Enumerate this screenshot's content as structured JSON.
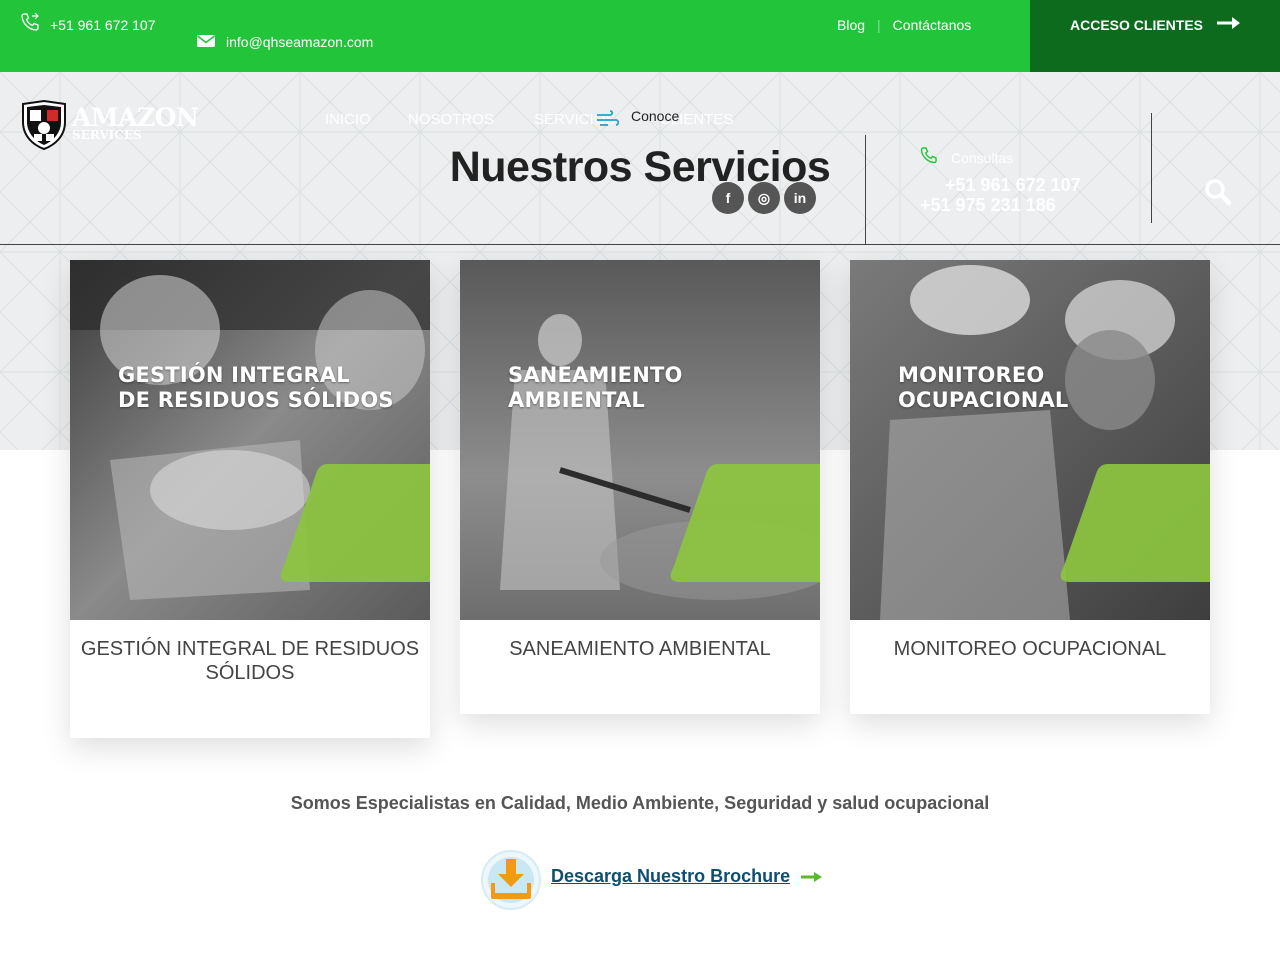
{
  "topbar": {
    "phone": "+51 961 672 107",
    "email": "info@qhseamazon.com",
    "links": [
      "Blog",
      "Contáctanos"
    ],
    "separator": "|",
    "cta": "ACCESO CLIENTES",
    "bg_color": "#22c43a",
    "cta_color": "#0d6b1d"
  },
  "header": {
    "logo_word": "AMAZON",
    "logo_sub": "SERVICES",
    "nav": [
      "INICIO",
      "NOSOTROS",
      "SERVICIOS",
      "CLIENTES"
    ],
    "conoce": "Conoce",
    "title": "Nuestros Servicios",
    "socials": [
      {
        "icon": "facebook-icon",
        "glyph": "f"
      },
      {
        "icon": "instagram-icon",
        "glyph": "◎"
      },
      {
        "icon": "linkedin-icon",
        "glyph": "in"
      }
    ],
    "consultas_label": "Consultas",
    "phones": [
      "+51 961 672 107",
      "+51 975 231 186"
    ]
  },
  "services": [
    {
      "overlay": [
        "GESTIÓN INTEGRAL",
        "DE RESIDUOS SÓLIDOS"
      ],
      "title": "GESTIÓN INTEGRAL DE RESIDUOS SÓLIDOS"
    },
    {
      "overlay": [
        "SANEAMIENTO",
        "AMBIENTAL"
      ],
      "title": "SANEAMIENTO AMBIENTAL"
    },
    {
      "overlay": [
        "MONITOREO",
        "OCUPACIONAL"
      ],
      "title": "MONITOREO OCUPACIONAL"
    }
  ],
  "tagline": "Somos Especialistas en Calidad, Medio Ambiente, Seguridad y salud ocupacional",
  "brochure": {
    "label": "Descarga Nuestro Brochure",
    "accent": "#5cb82e"
  },
  "colors": {
    "accent_green": "#8cc63f",
    "text_dark": "#222222"
  }
}
